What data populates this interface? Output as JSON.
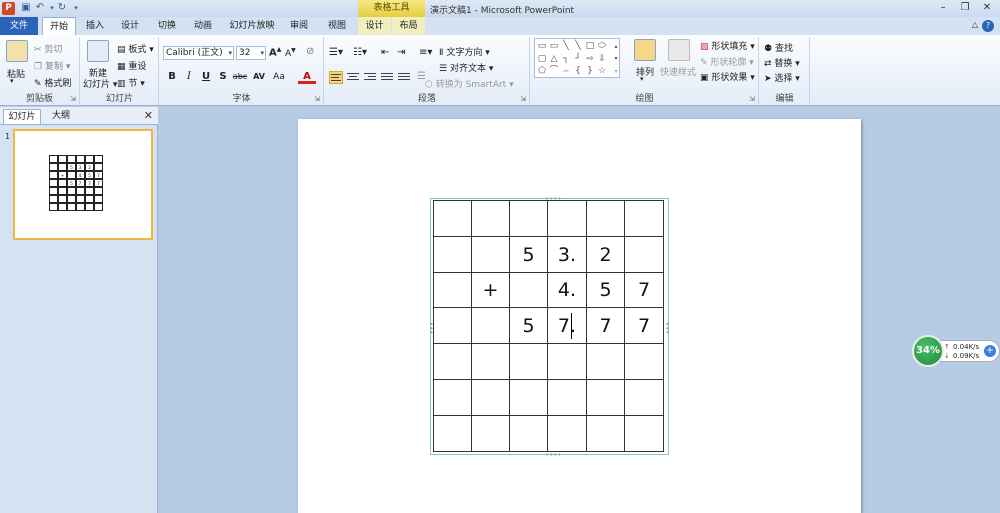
{
  "titlebar": {
    "app_icon": "P",
    "context_group": "表格工具",
    "title": "演示文稿1 - Microsoft PowerPoint"
  },
  "tabs": {
    "file": "文件",
    "home": "开始",
    "insert": "插入",
    "design": "设计",
    "transitions": "切换",
    "animations": "动画",
    "slideshow": "幻灯片放映",
    "review": "审阅",
    "view": "视图",
    "table_design": "设计",
    "table_layout": "布局"
  },
  "ribbon": {
    "clipboard": {
      "label": "剪贴板",
      "paste": "粘贴",
      "cut": "剪切",
      "copy": "复制",
      "format_painter": "格式刷"
    },
    "slides": {
      "label": "幻灯片",
      "new_slide_1": "新建",
      "new_slide_2": "幻灯片",
      "layout": "板式",
      "reset": "重设",
      "section": "节"
    },
    "font": {
      "label": "字体",
      "font_name": "Calibri (正文)",
      "font_size": "32",
      "bold": "B",
      "italic": "I",
      "underline": "U",
      "shadow": "S",
      "strike": "abc",
      "spacing": "AV",
      "case": "Aa",
      "color": "A",
      "grow": "A",
      "shrink": "A"
    },
    "paragraph": {
      "label": "段落",
      "text_direction": "文字方向",
      "align_text": "对齐文本",
      "smartart": "转换为 SmartArt"
    },
    "drawing": {
      "label": "绘图",
      "arrange": "排列",
      "quick_styles": "快速样式",
      "shape_fill": "形状填充",
      "shape_outline": "形状轮廓",
      "shape_effects": "形状效果"
    },
    "editing": {
      "label": "编辑",
      "find": "查找",
      "replace": "替换",
      "select": "选择"
    }
  },
  "left_panel": {
    "tab_slides": "幻灯片",
    "tab_outline": "大纲",
    "slide_number": "1"
  },
  "table": {
    "rows": [
      [
        "",
        "",
        "",
        "",
        "",
        ""
      ],
      [
        "",
        "",
        "5",
        "3.",
        "2",
        ""
      ],
      [
        "",
        "+",
        "",
        "4.",
        "5",
        "7"
      ],
      [
        "",
        "",
        "5",
        "7.",
        "7",
        "7"
      ],
      [
        "",
        "",
        "",
        "",
        "",
        ""
      ],
      [
        "",
        "",
        "",
        "",
        "",
        ""
      ],
      [
        "",
        "",
        "",
        "",
        "",
        ""
      ]
    ]
  },
  "net_widget": {
    "percent": "34%",
    "upload": "0.04K/s",
    "download": "0.09K/s"
  },
  "colors": {
    "file_tab": "#2b63b8",
    "context_tab": "#e6cd3f",
    "thumb_border": "#f0b740",
    "widget_green": "#1d8a3b"
  }
}
